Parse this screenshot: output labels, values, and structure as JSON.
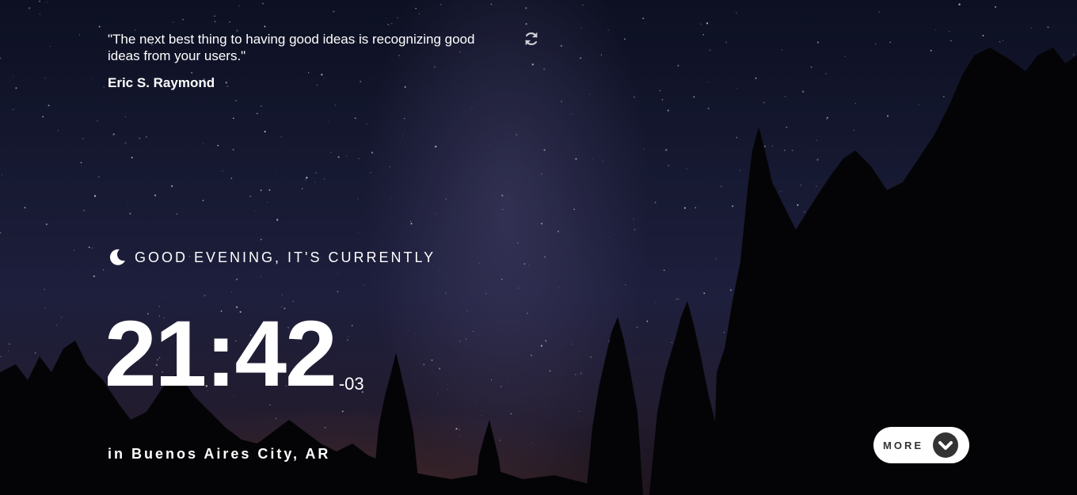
{
  "quote": {
    "text": "\"The next best thing to having good ideas is recognizing good ideas from your users.\"",
    "author": "Eric S. Raymond",
    "refresh_icon": "refresh-icon"
  },
  "greeting": {
    "icon": "moon-icon",
    "text": "GOOD EVENING, IT'S CURRENTLY"
  },
  "clock": {
    "time": "21:42",
    "timezone": "-03"
  },
  "location": {
    "text": "in Buenos Aires City, AR"
  },
  "more_button": {
    "label": "MORE",
    "icon": "chevron-down-icon"
  },
  "colors": {
    "text": "#ffffff",
    "button_bg": "#ffffff",
    "button_text": "#333333"
  }
}
